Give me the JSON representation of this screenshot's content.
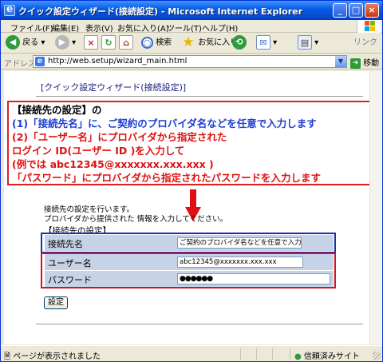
{
  "window": {
    "title": "クイック設定ウィザード(接続設定) - Microsoft Internet Explorer",
    "controls": [
      "_",
      "□",
      "×"
    ]
  },
  "menu": [
    "ファイル(F)",
    "編集(E)",
    "表示(V)",
    "お気に入り(A)",
    "ツール(T)",
    "ヘルプ(H)"
  ],
  "toolbar": {
    "back": "戻る",
    "search": "検索",
    "favorites": "お気に入り",
    "links": "リンク"
  },
  "address": {
    "label": "アドレス(D)",
    "url": "http://web.setup/wizard_main.html",
    "go": "移動"
  },
  "page": {
    "title": "[クイック設定ウィザード(接続設定)]",
    "note_lines": [
      "【接続先の設定】の",
      "(1)「接続先名」に、ご契約のプロバイダ名などを任意で入力します",
      "(2)「ユーザー名」にプロバイダから指定された",
      "ログイン ID(ユーザー ID )を入力して",
      "(例では abc12345@xxxxxxx.xxx.xxx )",
      "「パスワード」にプロバイダから指定されたパスワードを入力します"
    ],
    "desc1": "接続先の設定を行います。",
    "desc2": "プロバイダから提供された 情報を入力してください。",
    "section": "【接続先の設定】",
    "fields": {
      "conn_label": "接続先名",
      "conn_value": "ご契約のプロバイダ名などを任意で入力",
      "user_label": "ユーザー名",
      "user_value": "abc12345@xxxxxxx.xxx.xxx",
      "pass_label": "パスワード",
      "pass_value": "●●●●●●"
    },
    "submit": "設定"
  },
  "status": {
    "left": "ページが表示されました",
    "right": "信頼済みサイト"
  }
}
